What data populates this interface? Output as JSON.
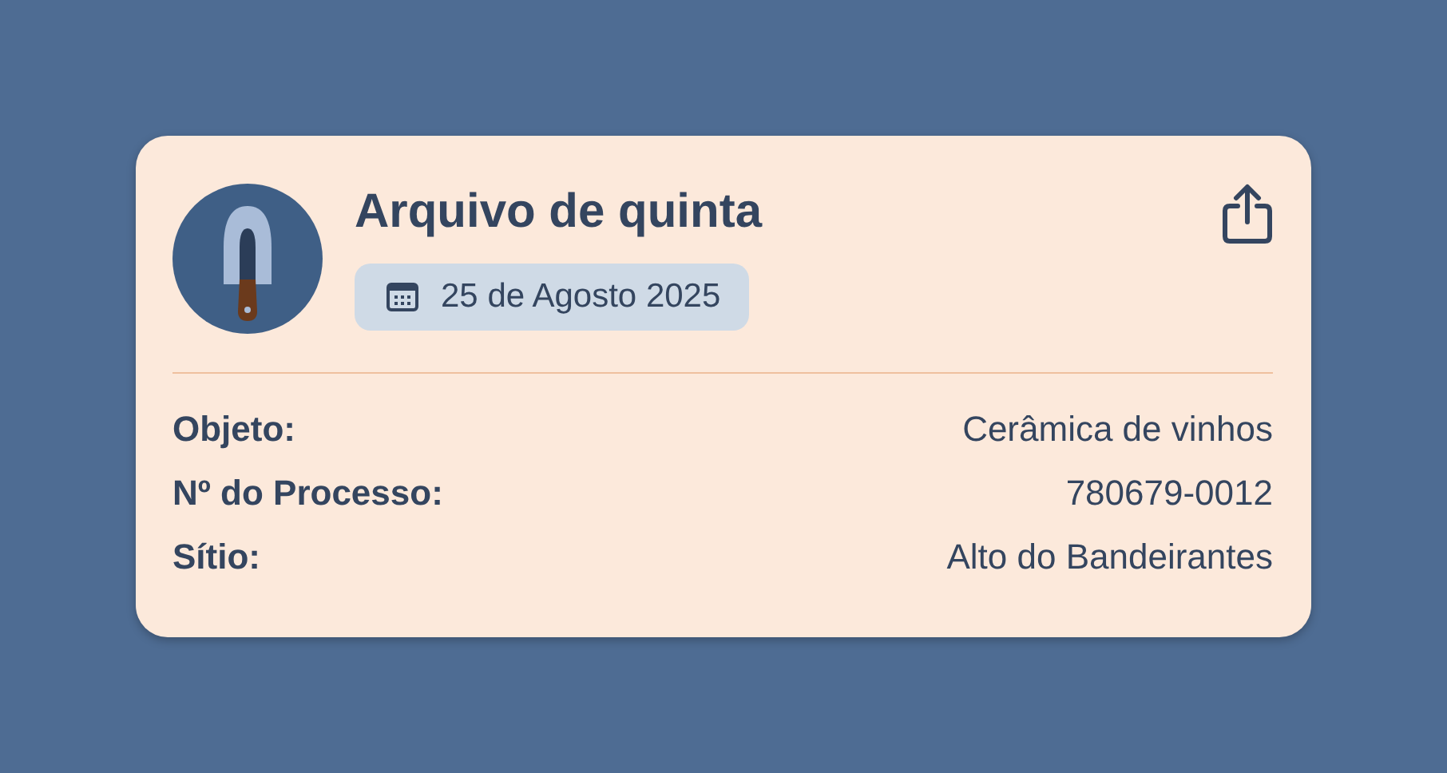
{
  "card": {
    "title": "Arquivo de quinta",
    "date": "25 de Agosto 2025",
    "fields": [
      {
        "label": "Objeto:",
        "value": "Cerâmica de vinhos"
      },
      {
        "label": "Nº do Processo:",
        "value": "780679-0012"
      },
      {
        "label": "Sítio:",
        "value": "Alto do Bandeirantes"
      }
    ]
  }
}
